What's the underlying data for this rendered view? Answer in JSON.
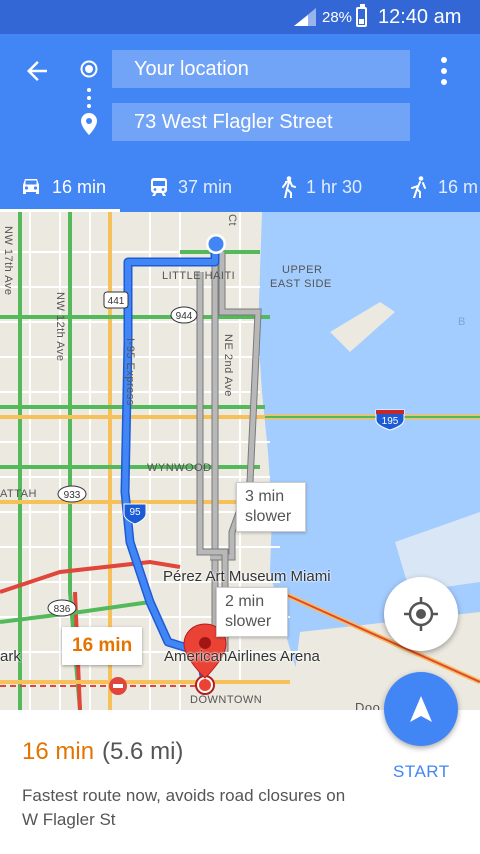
{
  "status_bar": {
    "battery_percent": "28%",
    "time": "12:40 am"
  },
  "route_inputs": {
    "origin_value": "Your location",
    "destination_value": "73 West Flagler Street"
  },
  "travel_modes": [
    {
      "mode": "drive",
      "icon": "car-icon",
      "duration": "16 min",
      "active": true
    },
    {
      "mode": "transit",
      "icon": "train-icon",
      "duration": "37 min",
      "active": false
    },
    {
      "mode": "walk",
      "icon": "walking-icon",
      "duration": "1 hr 30",
      "active": false
    },
    {
      "mode": "ride",
      "icon": "rideshare-icon",
      "duration": "16 m",
      "active": false
    }
  ],
  "map": {
    "labels": {
      "little_haiti": "LITTLE HAITI",
      "upper_east_side_1": "UPPER",
      "upper_east_side_2": "EAST SIDE",
      "wynwood": "WYNWOOD",
      "downtown": "DOWNTOWN",
      "nw17": "NW 17th Ave",
      "nw12": "NW 12th Ave",
      "i95": "I-95 Express",
      "ne2": "NE 2nd Ave",
      "attah": "ATTAH",
      "ark": "ark",
      "ct": "Ct",
      "doo": "Doo",
      "b": "B"
    },
    "shields": {
      "s441": "441",
      "s944": "944",
      "s933": "933",
      "s95": "95",
      "s195": "195",
      "s836": "836"
    },
    "poi": {
      "museum": "Pérez Art Museum Miami",
      "arena": "AmericanAirlines Arena"
    },
    "callouts": {
      "alt1_line1": "3 min",
      "alt1_line2": "slower",
      "alt2_line1": "2 min",
      "alt2_line2": "slower",
      "selected_time": "16 min"
    },
    "colors": {
      "route": "#4285f4",
      "alt_route": "#9e9e9e",
      "water": "#a3ccff",
      "destination": "#ea4335"
    }
  },
  "route_summary": {
    "duration": "16 min",
    "distance": "(5.6 mi)",
    "description": "Fastest route now, avoids road closures on W Flagler St",
    "start_label": "START"
  }
}
